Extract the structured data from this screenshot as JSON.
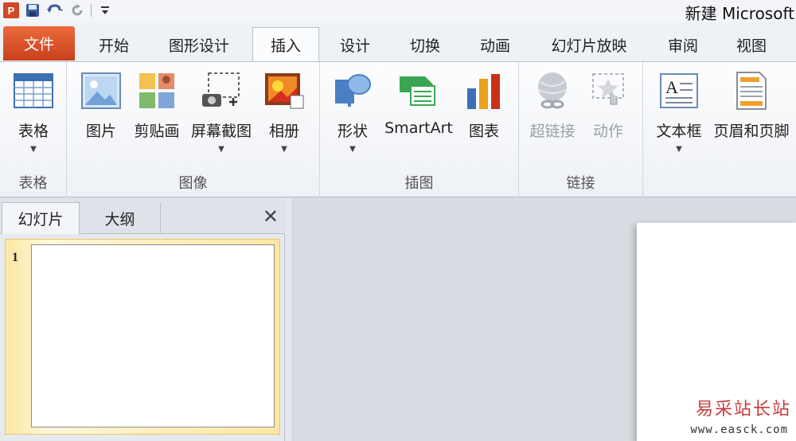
{
  "window": {
    "title": "新建 Microsoft"
  },
  "quick_access": {
    "app_icon": "P"
  },
  "tabs": [
    {
      "label": "文件"
    },
    {
      "label": "开始"
    },
    {
      "label": "图形设计"
    },
    {
      "label": "插入"
    },
    {
      "label": "设计"
    },
    {
      "label": "切换"
    },
    {
      "label": "动画"
    },
    {
      "label": "幻灯片放映"
    },
    {
      "label": "审阅"
    },
    {
      "label": "视图"
    }
  ],
  "ribbon": {
    "groups": [
      {
        "label": "表格",
        "buttons": [
          {
            "label": "表格",
            "icon": "table-icon"
          }
        ]
      },
      {
        "label": "图像",
        "buttons": [
          {
            "label": "图片",
            "icon": "picture-icon"
          },
          {
            "label": "剪贴画",
            "icon": "clipart-icon"
          },
          {
            "label": "屏幕截图",
            "icon": "screenshot-icon"
          },
          {
            "label": "相册",
            "icon": "photo-album-icon"
          }
        ]
      },
      {
        "label": "插图",
        "buttons": [
          {
            "label": "形状",
            "icon": "shapes-icon"
          },
          {
            "label": "SmartArt",
            "icon": "smartart-icon"
          },
          {
            "label": "图表",
            "icon": "chart-icon"
          }
        ]
      },
      {
        "label": "链接",
        "buttons": [
          {
            "label": "超链接",
            "icon": "hyperlink-icon"
          },
          {
            "label": "动作",
            "icon": "action-icon"
          }
        ]
      },
      {
        "label": "",
        "buttons": [
          {
            "label": "文本框",
            "icon": "textbox-icon"
          },
          {
            "label": "页眉和页脚",
            "icon": "header-footer-icon"
          }
        ]
      }
    ]
  },
  "left_panel": {
    "tabs": [
      {
        "label": "幻灯片"
      },
      {
        "label": "大纲"
      }
    ],
    "close_glyph": "✕",
    "slides": [
      {
        "number": "1"
      }
    ]
  },
  "watermark": {
    "text": "易采站长站",
    "url": "www.easck.com"
  },
  "colors": {
    "file_tab": "#d24726",
    "accent_selected": "#fde7a4",
    "ribbon_bg": "#eef1f5"
  }
}
